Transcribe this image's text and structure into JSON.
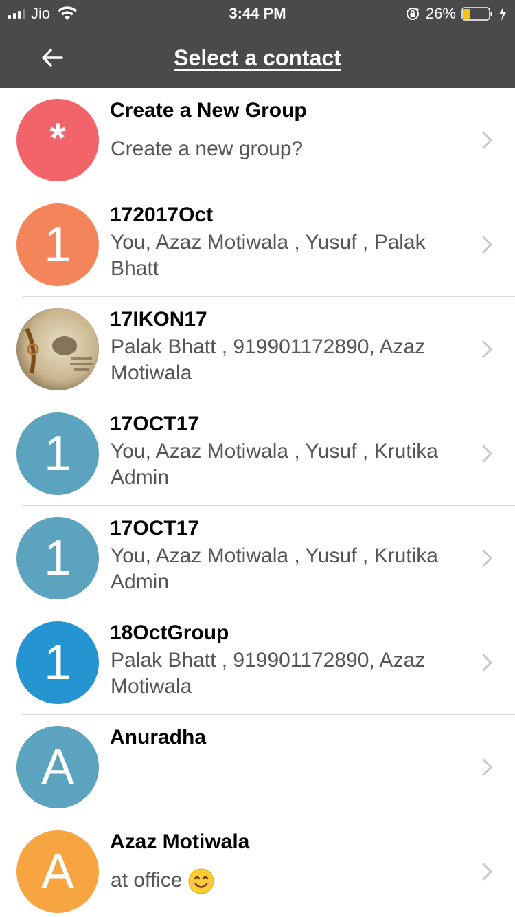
{
  "status_bar": {
    "carrier": "Jio",
    "time": "3:44 PM",
    "battery_percent": "26%",
    "battery_level": 0.26,
    "battery_color": "#f5c518"
  },
  "nav": {
    "title": "Select a contact",
    "back_icon": "arrow-left-icon"
  },
  "rows": [
    {
      "name": "Create a New Group",
      "sub": "Create a new group?",
      "avatar_text": "*",
      "avatar_color": "#f2636a"
    },
    {
      "name": "172017Oct",
      "sub": "You, Azaz Motiwala , Yusuf , Palak Bhatt",
      "avatar_text": "1",
      "avatar_color": "#f4845a"
    },
    {
      "name": "17IKON17",
      "sub": "Palak Bhatt , 919901172890, Azaz Motiwala",
      "avatar_text": "",
      "avatar_color": "#a08a6a"
    },
    {
      "name": "17OCT17",
      "sub": "You, Azaz Motiwala , Yusuf , Krutika Admin",
      "avatar_text": "1",
      "avatar_color": "#5ba3bf"
    },
    {
      "name": "17OCT17",
      "sub": "You, Azaz Motiwala , Yusuf , Krutika Admin",
      "avatar_text": "1",
      "avatar_color": "#5ba3bf"
    },
    {
      "name": "18OctGroup",
      "sub": "Palak Bhatt , 919901172890, Azaz Motiwala",
      "avatar_text": "1",
      "avatar_color": "#2495d1"
    },
    {
      "name": "Anuradha",
      "sub": "",
      "avatar_text": "A",
      "avatar_color": "#5ba3bf"
    },
    {
      "name": "Azaz Motiwala",
      "sub": "at office",
      "avatar_text": "A",
      "avatar_color": "#f7a541"
    }
  ],
  "colors": {
    "header_bg": "#4a4a4a",
    "divider": "#d9d9d9",
    "secondary_text": "#555555",
    "chevron": "#c7c7cc"
  }
}
